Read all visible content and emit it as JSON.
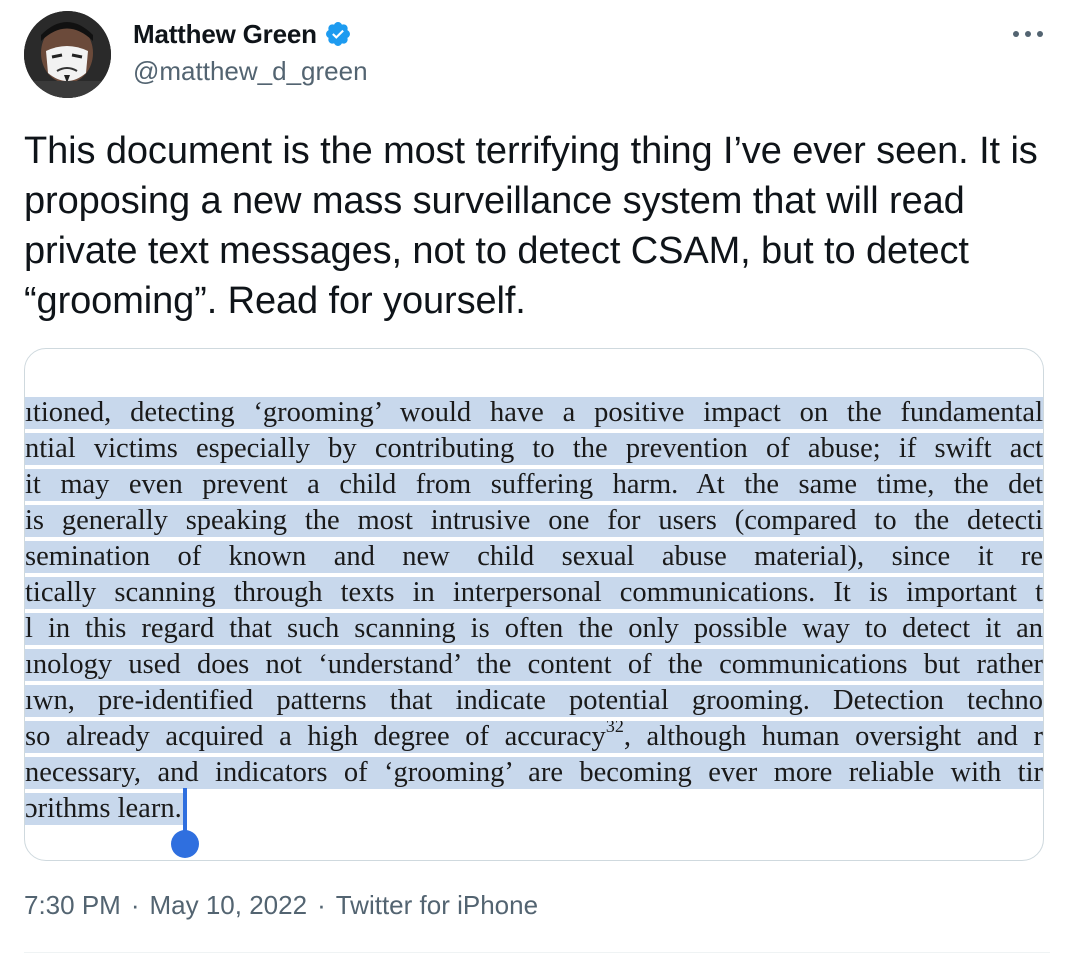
{
  "author": {
    "display_name": "Matthew Green",
    "handle": "@matthew_d_green",
    "verified": true,
    "verified_icon": "verified-badge-icon",
    "avatar": "avatar-image"
  },
  "more_icon": "more-horizontal-icon",
  "tweet": {
    "text": "This document is the most terrifying thing I’ve ever seen. It is proposing a new mass surveillance system that will read private text messages, not to detect CSAM, but to detect “grooming”. Read for yourself."
  },
  "media": {
    "document_lines": [
      "ıtioned, detecting ‘grooming’ would have a positive impact on the fundamental",
      "ntial victims especially by contributing to the prevention of abuse; if swift act",
      "it may even prevent a child from suffering harm. At the same time, the det",
      " is generally speaking the most intrusive one for users (compared to the detecti",
      "semination of known and new child sexual abuse material), since it re",
      "tically scanning through texts in interpersonal communications. It is important t",
      "l in this regard that such scanning is often the only possible way to detect it an",
      "ınology used does not ‘understand’ the content of the communications but rather",
      "ıwn, pre-identified patterns that indicate potential grooming. Detection techno",
      "so already acquired a high degree of accuracy",
      "necessary, and indicators of ‘grooming’ are becoming ever more reliable with tir",
      "ɔrithms learn."
    ],
    "line_10_suffix": ", although human oversight and r",
    "footnote_marker": "32",
    "highlight_color": "#c8d8ec",
    "selection_cursor_color": "#2f6fdf"
  },
  "meta": {
    "time": "7:30 PM",
    "separator": "·",
    "date": "May 10, 2022",
    "source": "Twitter for iPhone"
  },
  "colors": {
    "text_primary": "#0f1419",
    "text_secondary": "#536471",
    "verified_blue": "#1d9bf0",
    "border": "#cfd9de"
  }
}
